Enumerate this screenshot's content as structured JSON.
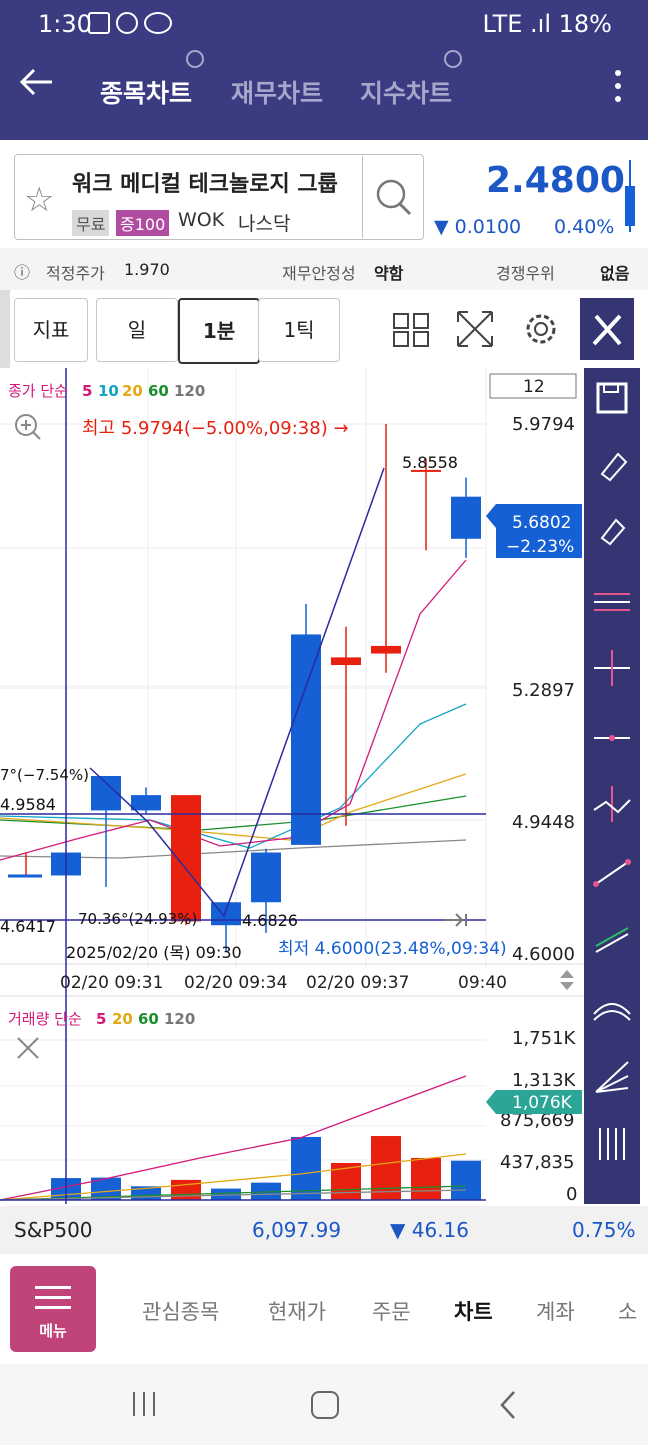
{
  "status_bar": {
    "time": "1:30",
    "right_text": "LTE  .ıl 18%"
  },
  "header": {
    "tabs": [
      "종목차트",
      "재무차트",
      "지수차트"
    ],
    "active_tab": 0
  },
  "stock": {
    "name": "워크 메디컬 테크놀로지 그룹",
    "tag_free": "무료",
    "tag_margin": "증100",
    "ticker": "WOK",
    "exchange": "나스닥",
    "price": "2.4800",
    "change": "▼ 0.0100",
    "change_pct": "0.40%"
  },
  "info_row": {
    "fair_label": "적정주가",
    "fair_value": "1.970",
    "stability_label": "재무안정성",
    "stability_value": "약함",
    "rank_label": "경쟁우위",
    "rank_value": "없음"
  },
  "toolbar": {
    "indicator": "지표",
    "periods": [
      "일",
      "1분",
      "1틱"
    ],
    "active_period": "1분"
  },
  "chart": {
    "count_box": "12",
    "legend_prefix": "종가 단순",
    "legend_ma": [
      "5",
      "10",
      "20",
      "60",
      "120"
    ],
    "high_annot": "최고 5.9794(−5.00%,09:38) →",
    "low_annot": "최저 4.6000(23.48%,09:34)",
    "price_ticks": [
      "5.9794",
      "5.2897",
      "4.9448",
      "4.6000"
    ],
    "current_price": "5.6802",
    "current_pct": "−2.23%",
    "mini_labels": [
      "5.8558",
      "4.6826",
      "70.36°(24.93%)",
      "7°(−7.54%)"
    ],
    "left_labels": [
      "4.9584",
      "4.6417"
    ],
    "date_label": "2025/02/20 (목) 09:30",
    "time_ticks": [
      "02/20 09:31",
      "02/20 09:34",
      "02/20 09:37",
      "09:40"
    ],
    "volume_legend_prefix": "거래량 단순",
    "volume_ma": [
      "5",
      "20",
      "60",
      "120"
    ],
    "volume_ticks": [
      "1,751K",
      "1,313K",
      "875,669",
      "437,835",
      "0"
    ],
    "volume_current": "1,076K"
  },
  "chart_data": [
    {
      "type": "candlestick",
      "title": "",
      "x": [
        "09:29",
        "09:30",
        "09:31",
        "09:32",
        "09:33",
        "09:34",
        "09:35",
        "09:36",
        "09:37",
        "09:38",
        "09:39",
        "09:40"
      ],
      "open": [
        4.8,
        4.86,
        5.06,
        5.01,
        4.68,
        4.73,
        4.86,
        5.43,
        5.35,
        5.38,
        5.86,
        5.79
      ],
      "high": [
        4.86,
        4.86,
        5.06,
        5.03,
        4.73,
        4.73,
        4.87,
        5.51,
        5.45,
        5.98,
        5.89,
        5.84
      ],
      "low": [
        4.8,
        4.8,
        4.77,
        4.96,
        4.67,
        4.6,
        4.65,
        4.88,
        4.93,
        5.33,
        5.65,
        5.63
      ],
      "close": [
        4.8,
        4.8,
        4.97,
        4.97,
        5.01,
        4.67,
        4.73,
        4.88,
        5.37,
        5.4,
        5.86,
        5.68
      ],
      "ylim": [
        4.6,
        5.98
      ]
    },
    {
      "type": "bar",
      "title": "",
      "categories": [
        "09:29",
        "09:30",
        "09:31",
        "09:32",
        "09:33",
        "09:34",
        "09:35",
        "09:36",
        "09:37",
        "09:38",
        "09:39",
        "09:40"
      ],
      "values": [
        10000,
        240000,
        245000,
        150000,
        220000,
        125000,
        190000,
        690000,
        405000,
        700000,
        460000,
        430000
      ],
      "ylim": [
        0,
        1751000
      ]
    }
  ],
  "sp500": {
    "label": "S&P500",
    "value": "6,097.99",
    "change": "▼ 46.16",
    "pct": "0.75%"
  },
  "bottom_menu": {
    "menu_label": "메뉴",
    "items": [
      "관심종목",
      "현재가",
      "주문",
      "차트",
      "계좌",
      "소"
    ],
    "active": "차트"
  },
  "colors": {
    "header": "#3b3b82",
    "up": "#e8200f",
    "down": "#1560d4",
    "accent": "#1b57c5"
  }
}
